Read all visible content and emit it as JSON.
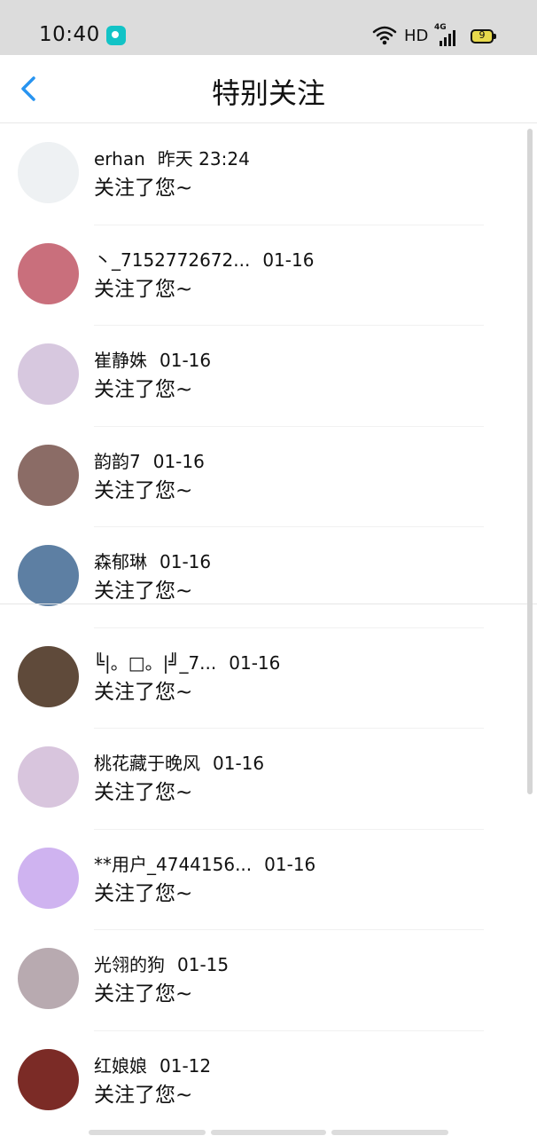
{
  "status_bar": {
    "time": "10:40",
    "network": "HD",
    "lte": "4G",
    "battery": "9"
  },
  "header": {
    "title": "特别关注"
  },
  "list": [
    {
      "name": "erhan",
      "time": "昨天 23:24",
      "message": "关注了您~",
      "avatar_color": "#eef1f3"
    },
    {
      "name": "丶_7152772672...",
      "time": "01-16",
      "message": "关注了您~",
      "avatar_color": "#c96f7c"
    },
    {
      "name": "崔静姝",
      "time": "01-16",
      "message": "关注了您~",
      "avatar_color": "#d7c8df"
    },
    {
      "name": "韵韵7",
      "time": "01-16",
      "message": "关注了您~",
      "avatar_color": "#8b6c66"
    },
    {
      "name": "森郁琳",
      "time": "01-16",
      "message": "关注了您~",
      "avatar_color": "#5d7fa3"
    },
    {
      "name": "╚|。□。|╝_7...",
      "time": "01-16",
      "message": "关注了您~",
      "avatar_color": "#5f4a3a"
    },
    {
      "name": "桃花藏于晚风",
      "time": "01-16",
      "message": "关注了您~",
      "avatar_color": "#d8c5dd"
    },
    {
      "name": "**用户_4744156...",
      "time": "01-16",
      "message": "关注了您~",
      "avatar_color": "#cfb3f0"
    },
    {
      "name": "光翎的狗",
      "time": "01-15",
      "message": "关注了您~",
      "avatar_color": "#b8aab0"
    },
    {
      "name": "红娘娘",
      "time": "01-12",
      "message": "关注了您~",
      "avatar_color": "#7b2b26"
    }
  ]
}
